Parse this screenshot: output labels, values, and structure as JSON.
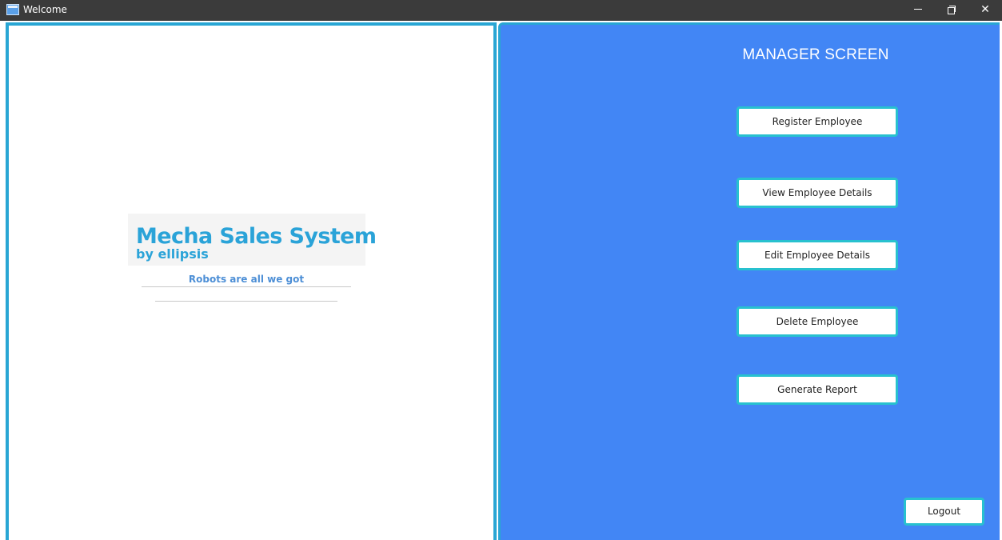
{
  "window": {
    "title": "Welcome",
    "minimize_icon": "minimize-icon",
    "restore_icon": "restore-icon",
    "close_label": "✕"
  },
  "branding": {
    "logo_title": "Mecha Sales System",
    "logo_subtitle": "by ellipsis",
    "tagline": "Robots are all we got"
  },
  "manager": {
    "screen_title": "MANAGER SCREEN",
    "buttons": [
      {
        "label": "Register Employee"
      },
      {
        "label": "View Employee Details"
      },
      {
        "label": "Edit Employee Details"
      },
      {
        "label": "Delete Employee"
      },
      {
        "label": "Generate Report"
      }
    ],
    "logout_label": "Logout"
  },
  "colors": {
    "accent_border": "#29a6d4",
    "button_border": "#28c1cf",
    "panel_blue": "#4286f5",
    "logo_blue": "#2aa3d8",
    "titlebar": "#3b3b3b"
  }
}
